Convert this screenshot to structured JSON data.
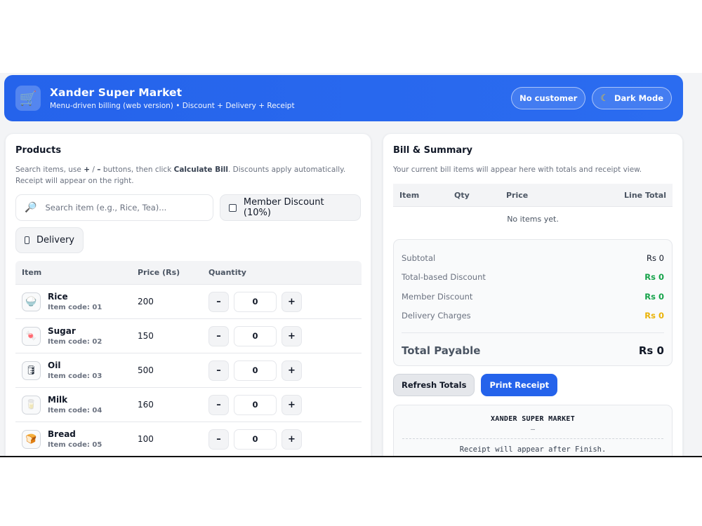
{
  "header": {
    "title": "Xander Super Market",
    "subtitle": "Menu-driven billing (web version) • Discount + Delivery + Receipt",
    "logo_icon": "cart-icon",
    "customer_button": "No customer",
    "dark_mode_button": "Dark Mode"
  },
  "products": {
    "title": "Products",
    "desc_pre": "Search items, use ",
    "desc_plus": "+",
    "desc_mid1": " / ",
    "desc_minus": "–",
    "desc_mid2": " buttons, then click ",
    "desc_bold": "Calculate Bill",
    "desc_post": ". Discounts apply automatically. Receipt will appear on the right.",
    "search_placeholder": "Search item (e.g., Rice, Tea)...",
    "member_discount_label": "Member Discount (10%)",
    "delivery_label": "Delivery",
    "columns": {
      "item": "Item",
      "price": "Price (Rs)",
      "quantity": "Quantity"
    },
    "minus_label": "–",
    "plus_label": "+",
    "items": [
      {
        "name": "Rice",
        "code": "Item code: 01",
        "price": "200",
        "qty": "0",
        "icon": "rice-bowl-icon"
      },
      {
        "name": "Sugar",
        "code": "Item code: 02",
        "price": "150",
        "qty": "0",
        "icon": "sugar-icon"
      },
      {
        "name": "Oil",
        "code": "Item code: 03",
        "price": "500",
        "qty": "0",
        "icon": "oil-bottle-icon"
      },
      {
        "name": "Milk",
        "code": "Item code: 04",
        "price": "160",
        "qty": "0",
        "icon": "milk-glass-icon"
      },
      {
        "name": "Bread",
        "code": "Item code: 05",
        "price": "100",
        "qty": "0",
        "icon": "bread-icon"
      }
    ]
  },
  "bill": {
    "title": "Bill & Summary",
    "desc": "Your current bill items will appear here with totals and receipt view.",
    "columns": {
      "item": "Item",
      "qty": "Qty",
      "price": "Price",
      "line_total": "Line Total"
    },
    "empty": "No items yet.",
    "summary": {
      "subtotal_label": "Subtotal",
      "subtotal_value": "Rs 0",
      "total_discount_label": "Total-based Discount",
      "total_discount_value": "Rs 0",
      "member_discount_label": "Member Discount",
      "member_discount_value": "Rs 0",
      "delivery_label": "Delivery Charges",
      "delivery_value": "Rs 0",
      "total_label": "Total Payable",
      "total_value": "Rs 0"
    },
    "refresh_button": "Refresh Totals",
    "print_button": "Print Receipt",
    "receipt": {
      "title": "XANDER SUPER MARKET",
      "dash": "—",
      "message": "Receipt will appear after Finish."
    }
  },
  "colors": {
    "accent": "#2563eb",
    "discount": "#16a34a",
    "delivery": "#eab308"
  }
}
